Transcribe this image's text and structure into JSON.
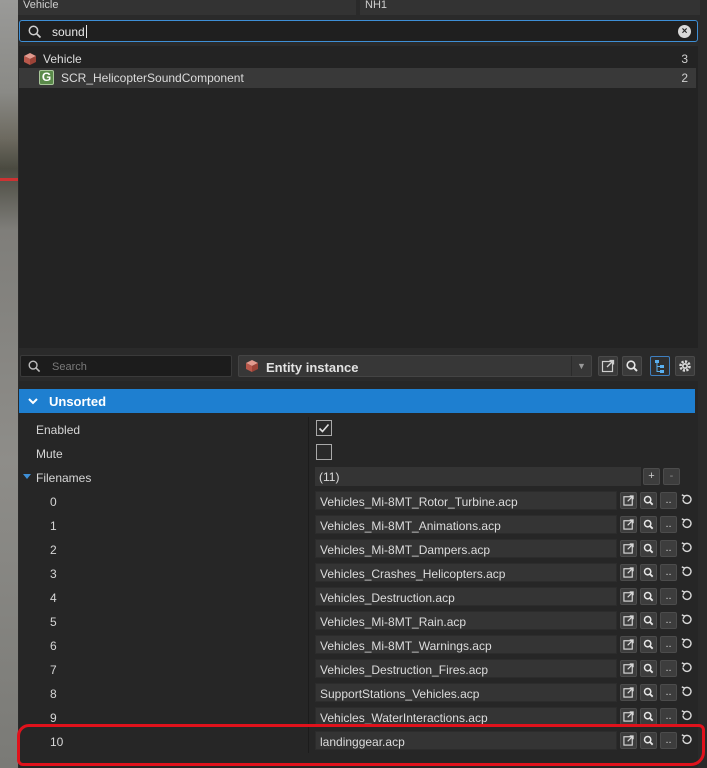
{
  "top_fields": {
    "left": "Vehicle",
    "right": "NH1"
  },
  "search": {
    "value": "sound"
  },
  "tree": {
    "items": [
      {
        "label": "Vehicle",
        "count": "3",
        "icon": "entity-cube-icon"
      },
      {
        "label": "SCR_HelicopterSoundComponent",
        "count": "2",
        "icon": "component-g-icon"
      }
    ]
  },
  "properties_toolbar": {
    "search_placeholder": "Search",
    "entity_selector": "Entity instance",
    "buttons": [
      "open-external-icon",
      "search-icon",
      "hierarchy-icon",
      "gear-icon"
    ]
  },
  "section": {
    "label": "Unsorted"
  },
  "properties": {
    "enabled_label": "Enabled",
    "mute_label": "Mute",
    "filenames_label": "Filenames",
    "filenames_count": "(11)",
    "add_label": "+",
    "remove_label": "-",
    "browse_label": "..",
    "files": [
      {
        "index": "0",
        "value": "Vehicles_Mi-8MT_Rotor_Turbine.acp"
      },
      {
        "index": "1",
        "value": "Vehicles_Mi-8MT_Animations.acp"
      },
      {
        "index": "2",
        "value": "Vehicles_Mi-8MT_Dampers.acp"
      },
      {
        "index": "3",
        "value": "Vehicles_Crashes_Helicopters.acp"
      },
      {
        "index": "4",
        "value": "Vehicles_Destruction.acp"
      },
      {
        "index": "5",
        "value": "Vehicles_Mi-8MT_Rain.acp"
      },
      {
        "index": "6",
        "value": "Vehicles_Mi-8MT_Warnings.acp"
      },
      {
        "index": "7",
        "value": "Vehicles_Destruction_Fires.acp"
      },
      {
        "index": "8",
        "value": "SupportStations_Vehicles.acp"
      },
      {
        "index": "9",
        "value": "Vehicles_WaterInteractions.acp"
      },
      {
        "index": "10",
        "value": "landinggear.acp"
      }
    ]
  },
  "colors": {
    "accent": "#1e7fd0",
    "focus": "#3e8fd6",
    "highlight": "#e0121c"
  }
}
